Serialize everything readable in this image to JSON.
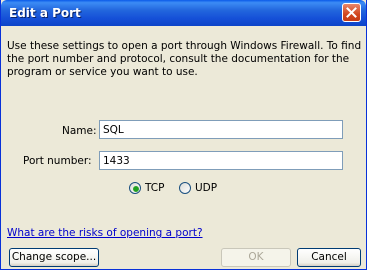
{
  "window": {
    "title": "Edit a Port"
  },
  "description": "Use these settings to open a port through Windows Firewall. To find the port number and protocol, consult the documentation for the program or service you want to use.",
  "form": {
    "name_label": "Name:",
    "name_value": "SQL",
    "port_label": "Port number:",
    "port_value": "1433",
    "protocol_options": [
      "TCP",
      "UDP"
    ],
    "protocol_selected": "TCP"
  },
  "link_text": "What are the risks of opening a port?",
  "buttons": {
    "change_scope": "Change scope...",
    "ok": "OK",
    "cancel": "Cancel"
  },
  "colors": {
    "title_bar": "#1550d8",
    "dialog_bg": "#ece9d8",
    "close_button": "#d2471f",
    "link": "#0000cc"
  }
}
